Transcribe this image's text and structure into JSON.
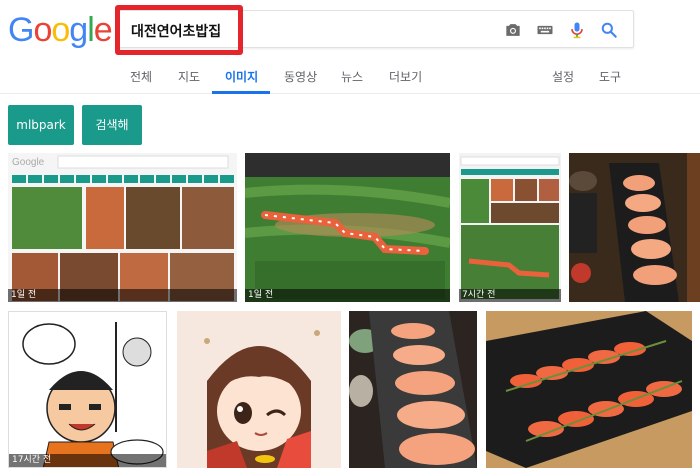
{
  "logo": {
    "text": "Google",
    "letters": [
      "G",
      "o",
      "o",
      "g",
      "l",
      "e"
    ],
    "colors": [
      "#4285F4",
      "#EA4335",
      "#FBBC05",
      "#4285F4",
      "#34A853",
      "#EA4335"
    ]
  },
  "search": {
    "query": "대전연어초밥집"
  },
  "search_icons": [
    "camera-icon",
    "keyboard-icon",
    "microphone-icon",
    "search-icon"
  ],
  "tabs": {
    "all": "전체",
    "maps": "지도",
    "images": "이미지",
    "videos": "동영상",
    "news": "뉴스",
    "more": "더보기",
    "settings": "설정",
    "tools": "도구"
  },
  "chips": [
    "mlbpark",
    "검색해"
  ],
  "accent": "#1a73e8",
  "chip_color": "#1a9a8b",
  "results": [
    {
      "label": "1일 전"
    },
    {
      "label": "1일 전"
    },
    {
      "label": "7시간 전"
    },
    {
      "label": ""
    },
    {
      "label": "17시간 전"
    },
    {
      "label": ""
    },
    {
      "label": ""
    },
    {
      "label": ""
    }
  ]
}
